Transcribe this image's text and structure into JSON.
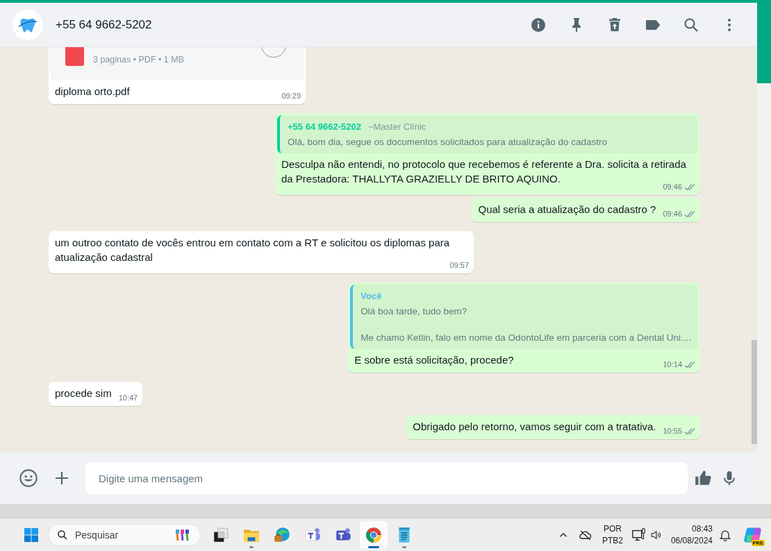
{
  "header": {
    "contact": "+55 64 9662-5202"
  },
  "messages": [
    {
      "kind": "document",
      "outgoing": false,
      "file_meta": "3 paginas • PDF • 1 MB",
      "caption": "diploma orto.pdf",
      "time": "09:29"
    },
    {
      "kind": "reply",
      "outgoing": true,
      "quote": {
        "author": "+55 64 9662-5202",
        "author_note": "~Master Clínic",
        "text": "Olá, bom dia, segue os documentos solicitados para atualização do cadastro",
        "color": "#06cf9c"
      },
      "text": "Desculpa não entendi, no protocolo que recebemos é referente a Dra. solicita a retirada da Prestadora: THALLYTA GRAZIELLY DE BRITO AQUINO.",
      "time": "09:46",
      "read": false
    },
    {
      "kind": "text",
      "outgoing": true,
      "text": "Qual seria a atualização do cadastro ?",
      "time": "09:46",
      "read": false
    },
    {
      "kind": "text",
      "outgoing": false,
      "text": "um outroo contato de vocês entrou em contato com a RT e solicitou os diplomas para atualização cadastral",
      "time": "09:57"
    },
    {
      "kind": "reply",
      "outgoing": true,
      "quote": {
        "author": "Você",
        "text": "Olá boa tarde, tudo bem?\n\nMe chamo Ketlin, falo em nome da OdontoLife em parceria com a Dental Uni....",
        "color": "#53bdeb"
      },
      "text": "E sobre está solicitação, procede?",
      "time": "10:14",
      "read": false
    },
    {
      "kind": "text",
      "outgoing": false,
      "text": "procede sim",
      "time": "10:47"
    },
    {
      "kind": "text",
      "outgoing": true,
      "text": "Obrigado pelo retorno, vamos seguir com a tratativa.",
      "time": "10:55",
      "read": false
    }
  ],
  "composer": {
    "placeholder": "Digite uma mensagem"
  },
  "taskbar": {
    "search": {
      "placeholder": "Pesquisar"
    },
    "apps": [
      {
        "kind": "task-view",
        "open": false,
        "selected": false
      },
      {
        "kind": "folder",
        "open": true,
        "selected": false
      },
      {
        "kind": "edge",
        "open": false,
        "selected": false
      },
      {
        "kind": "teams-classic",
        "open": false,
        "selected": false
      },
      {
        "kind": "teams",
        "open": false,
        "selected": false
      },
      {
        "kind": "chrome",
        "open": true,
        "selected": true
      },
      {
        "kind": "notepad",
        "open": true,
        "selected": false
      }
    ],
    "language": "POR",
    "layout": "PTB2",
    "time": "08:43",
    "date": "06/08/2024",
    "copilot_badge": "PRE"
  }
}
